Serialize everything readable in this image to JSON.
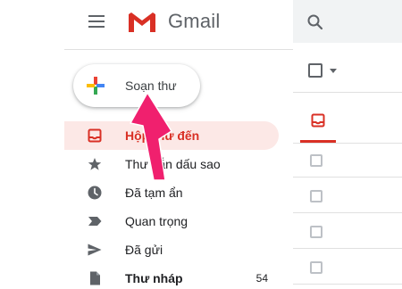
{
  "app": {
    "name": "Gmail"
  },
  "compose": {
    "label": "Soạn thư"
  },
  "nav": {
    "items": [
      {
        "id": "inbox",
        "label": "Hộp thư đến",
        "icon": "inbox-icon",
        "count": "",
        "active": true
      },
      {
        "id": "starred",
        "label": "Thư gắn dấu sao",
        "icon": "star-icon",
        "count": ""
      },
      {
        "id": "snoozed",
        "label": "Đã tạm ẩn",
        "icon": "clock-icon",
        "count": ""
      },
      {
        "id": "important",
        "label": "Quan trọng",
        "icon": "label-important-icon",
        "count": ""
      },
      {
        "id": "sent",
        "label": "Đã gửi",
        "icon": "send-icon",
        "count": ""
      },
      {
        "id": "drafts",
        "label": "Thư nháp",
        "icon": "draft-icon",
        "count": "54",
        "bold": true
      }
    ]
  },
  "colors": {
    "accent_red": "#d93025",
    "active_bg": "#fce8e6",
    "icon_gray": "#5f6368",
    "annotation_arrow": "#f0206e"
  }
}
